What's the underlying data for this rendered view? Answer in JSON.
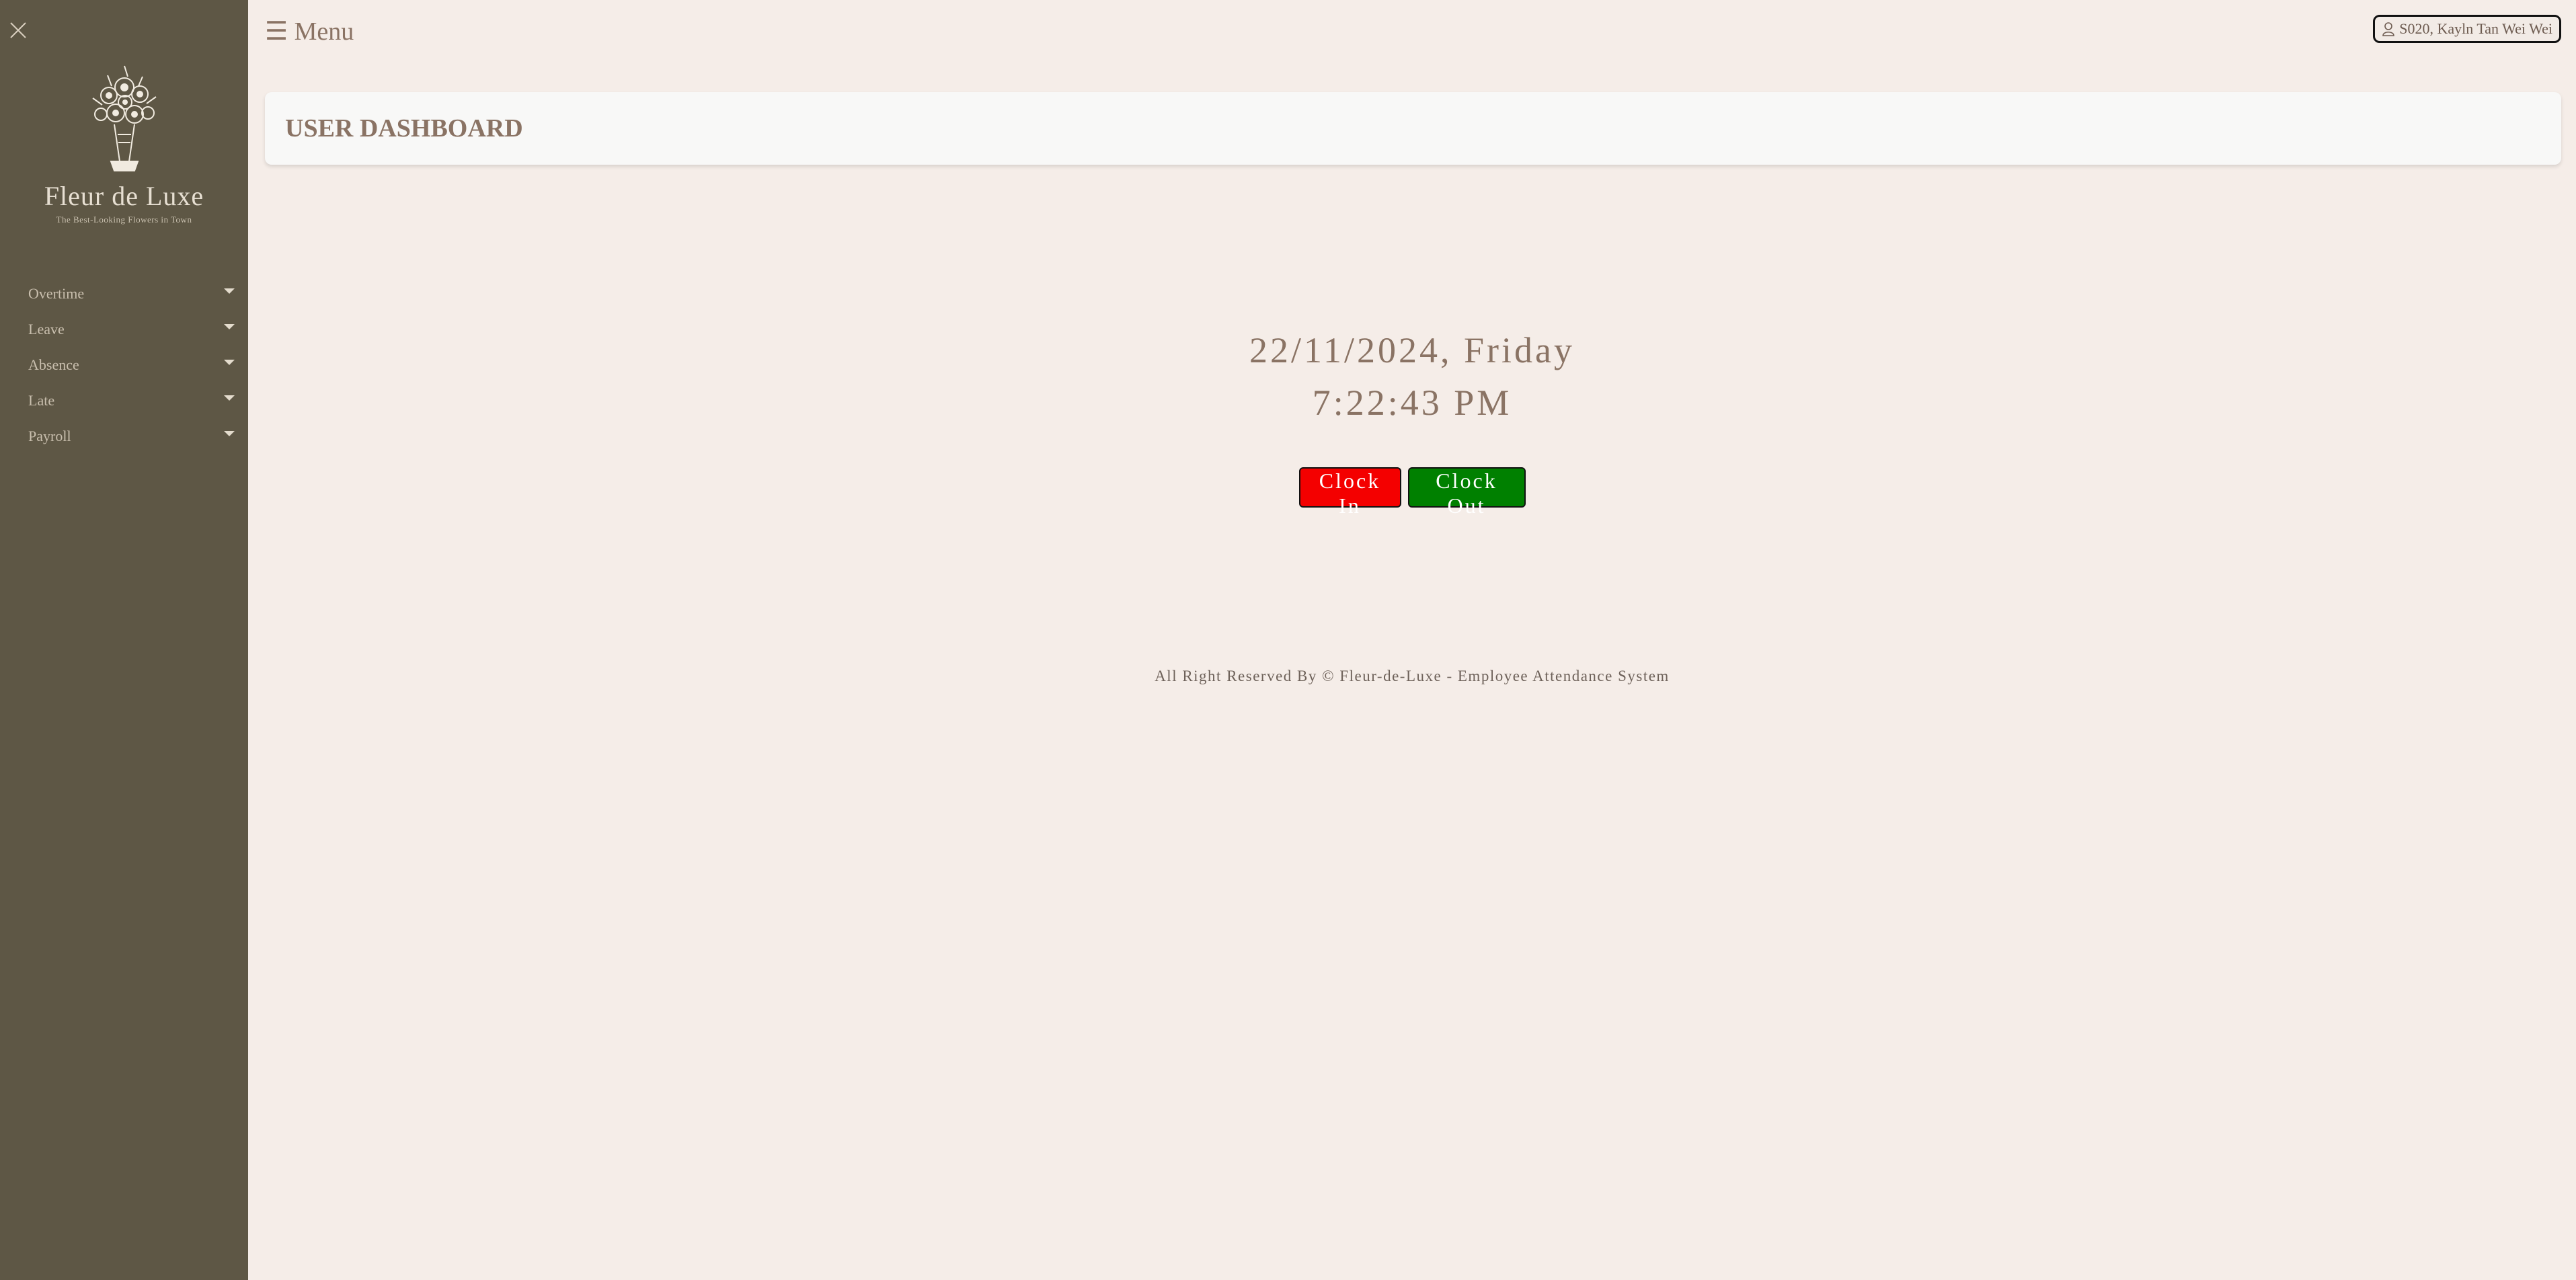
{
  "sidebar": {
    "brand": {
      "name": "Fleur de Luxe",
      "tagline": "The Best-Looking Flowers in Town"
    },
    "items": [
      {
        "label": "Overtime"
      },
      {
        "label": "Leave"
      },
      {
        "label": "Absence"
      },
      {
        "label": "Late"
      },
      {
        "label": "Payroll"
      }
    ]
  },
  "topbar": {
    "menu_label": "☰ Menu",
    "user_label": "S020, Kayln Tan Wei Wei"
  },
  "header": {
    "title": "USER DASHBOARD"
  },
  "main": {
    "date": "22/11/2024, Friday",
    "time": "7:22:43 PM",
    "clock_in_label": "Clock In",
    "clock_out_label": "Clock Out"
  },
  "footer": {
    "text": "All Right Reserved By © Fleur-de-Luxe - Employee Attendance System"
  },
  "colors": {
    "sidebar_bg": "#5e5745",
    "page_bg": "#f5ede8",
    "accent_text": "#8a7364",
    "clock_in": "#f40000",
    "clock_out": "#008000"
  }
}
